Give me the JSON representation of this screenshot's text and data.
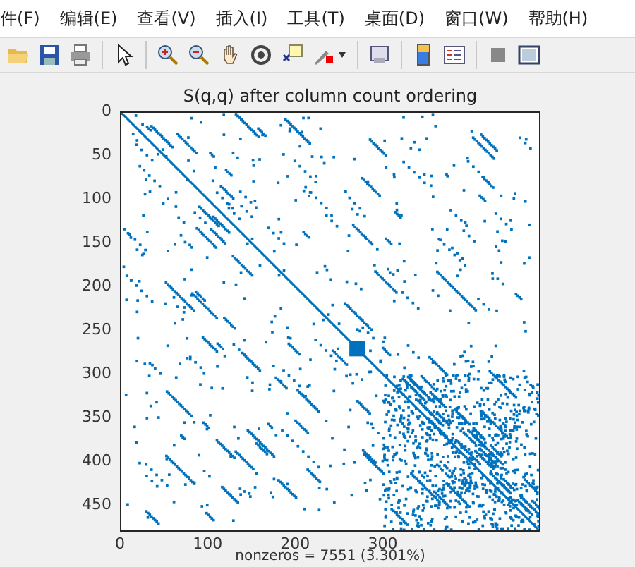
{
  "menu": [
    "件(F)",
    "编辑(E)",
    "查看(V)",
    "插入(I)",
    "工具(T)",
    "桌面(D)",
    "窗口(W)",
    "帮助(H)"
  ],
  "plot": {
    "title": "S(q,q) after column count ordering",
    "xlabel": "nonzeros = 7551 (3.301%)",
    "xticks": [
      "0",
      "100",
      "200",
      "300"
    ],
    "yticks": [
      "0",
      "50",
      "100",
      "150",
      "200",
      "250",
      "300",
      "350",
      "400",
      "450"
    ]
  }
}
